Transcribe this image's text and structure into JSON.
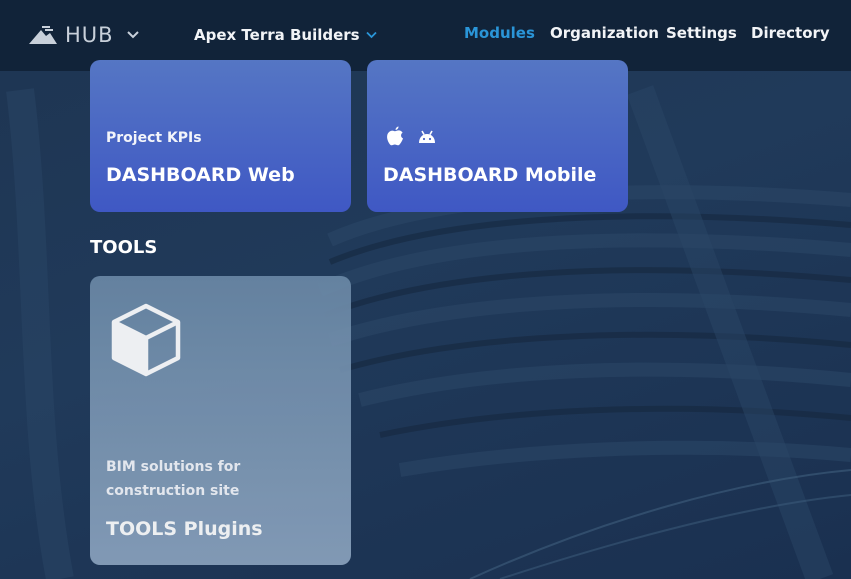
{
  "header": {
    "logo_text": "HUB",
    "organization": "Apex Terra Builders",
    "nav": [
      "Modules",
      "Organization",
      "Settings",
      "Directory"
    ],
    "active_nav": "Modules"
  },
  "cards": {
    "dashboard_web": {
      "subtitle": "Project KPIs",
      "title": "DASHBOARD Web"
    },
    "dashboard_mobile": {
      "title": "DASHBOARD Mobile",
      "platform_icons": [
        "apple-icon",
        "android-icon"
      ]
    },
    "tools_plugins": {
      "subtitle_line1": "BIM solutions for",
      "subtitle_line2": "construction site",
      "title": "TOOLS Plugins",
      "icon": "cube-icon"
    }
  },
  "sections": {
    "tools": "TOOLS"
  },
  "colors": {
    "topbar": "#112339",
    "active_nav": "#2a95d8",
    "card_blue": "#4a65c4",
    "card_gray": "#7a93ae"
  }
}
